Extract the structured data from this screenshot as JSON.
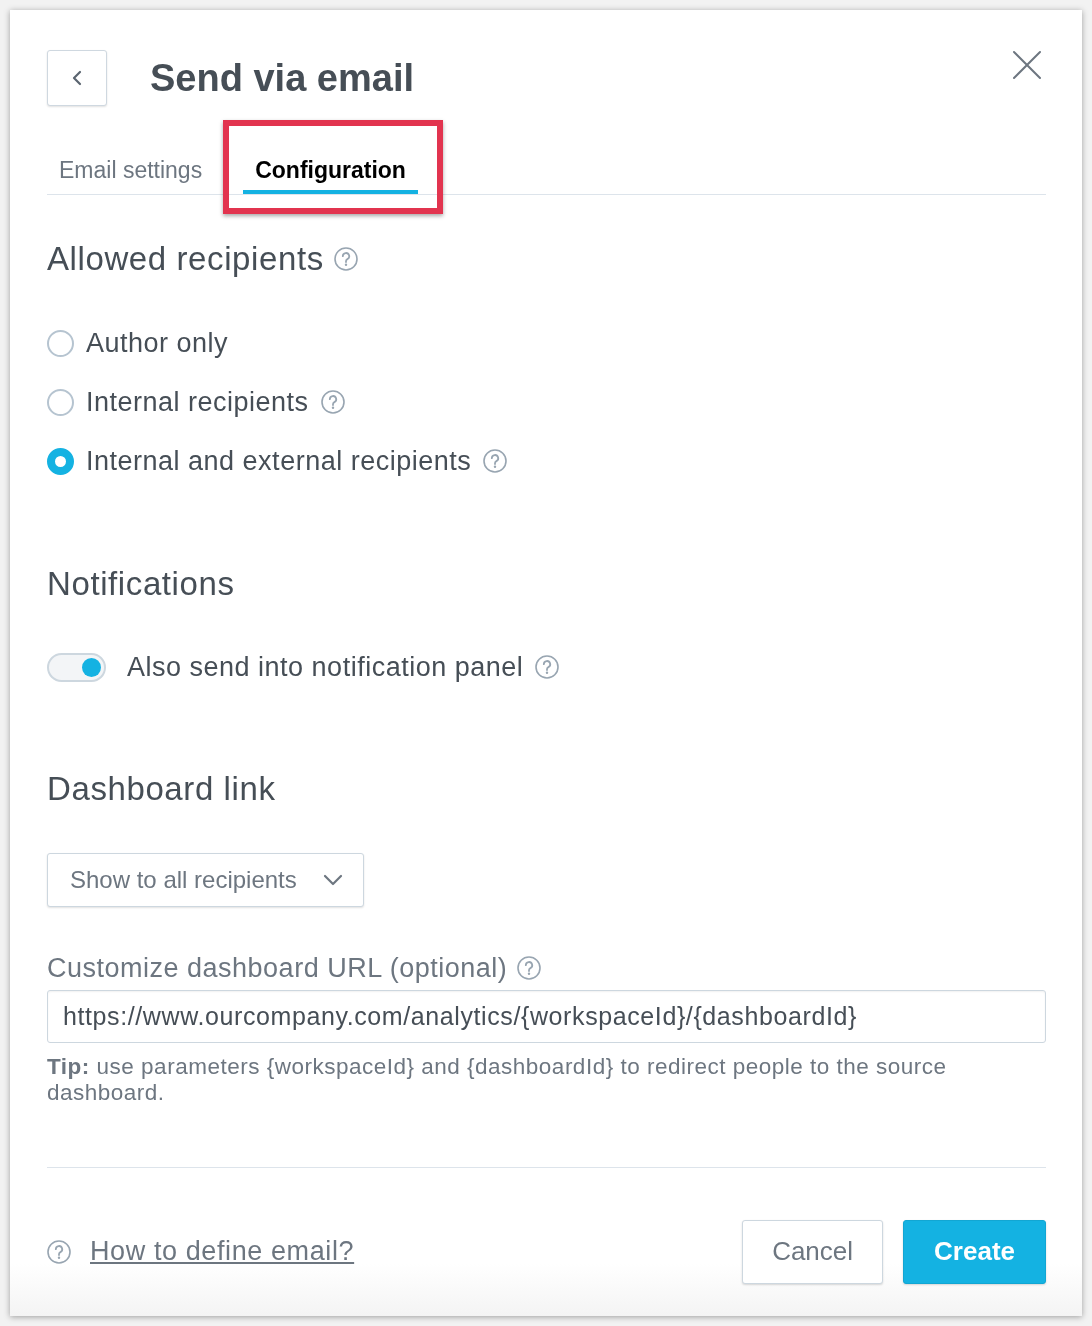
{
  "header": {
    "title": "Send via email"
  },
  "tabs": [
    {
      "label": "Email settings",
      "selected": false,
      "highlighted": false
    },
    {
      "label": "Configuration",
      "selected": true,
      "highlighted": true
    }
  ],
  "allowed_recipients": {
    "heading": "Allowed recipients",
    "help": true,
    "options": [
      {
        "label": "Author only",
        "selected": false,
        "help": false
      },
      {
        "label": "Internal recipients",
        "selected": false,
        "help": true
      },
      {
        "label": "Internal and external recipients",
        "selected": true,
        "help": true
      }
    ]
  },
  "notifications": {
    "heading": "Notifications",
    "toggle": {
      "label": "Also send into notification panel",
      "on": true,
      "help": true
    }
  },
  "dashboard_link": {
    "heading": "Dashboard link",
    "dropdown": {
      "value": "Show to all recipients"
    },
    "url_field": {
      "label": "Customize dashboard URL (optional)",
      "help": true,
      "value": "https://www.ourcompany.com/analytics/{workspaceId}/{dashboardId}"
    },
    "tip": "**Tip:** use parameters {workspaceId} and {dashboardId} to redirect people to the source dashboard."
  },
  "footer": {
    "help_link": "How to define email?",
    "buttons": [
      {
        "label": "Cancel",
        "kind": "secondary"
      },
      {
        "label": "Create",
        "kind": "primary"
      }
    ]
  }
}
